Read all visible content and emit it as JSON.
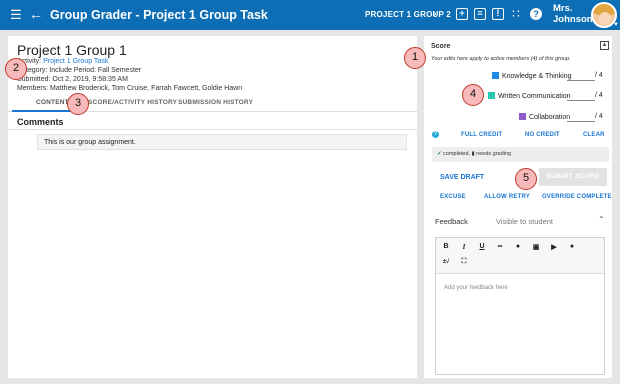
{
  "topbar": {
    "title": "Group Grader - Project 1 Group Task",
    "crumb": "PROJECT 1 GROUP 2",
    "user_first": "Mrs.",
    "user_last": "Johnson",
    "bg_color": "#0d6eb5"
  },
  "left": {
    "project_title": "Project 1 Group 1",
    "activity_label": "Activity:",
    "activity_link": "Project 1 Group Task",
    "category_line": "Category: Include   Period: Fall Semester",
    "submitted_line": "Submitted: Oct 2, 2019, 9:58:35 AM",
    "members_line": "Members:  Matthew Broderick, Tom Cruise, Farrah Fawcett, Goldie Hawn",
    "tabs": [
      {
        "label": "CONTENT"
      },
      {
        "label": "SCORE/ACTIVITY HISTORY"
      },
      {
        "label": "SUBMISSION HISTORY"
      }
    ],
    "comments_heading": "Comments",
    "comment_text": "This is our group assignment."
  },
  "right": {
    "score_heading": "Score",
    "score_note": "Your edits here apply to active members (4) of this group.",
    "criteria": [
      {
        "name": "Knowledge & Thinking",
        "max": "/ 4",
        "color": "#1e88e5"
      },
      {
        "name": "Written Communication",
        "max": "/ 4",
        "color": "#26c6b0"
      },
      {
        "name": "Collaboration",
        "max": "/ 4",
        "color": "#8e5cc9"
      }
    ],
    "full_credit": "FULL CREDIT",
    "no_credit": "NO CREDIT",
    "clear": "CLEAR",
    "status_completed": "completed,",
    "status_needs": "needs grading",
    "save_draft": "SAVE DRAFT",
    "submit_score": "SUBMIT SCORE",
    "excuse": "EXCUSE",
    "allow_retry": "ALLOW RETRY",
    "override_complete": "OVERRIDE COMPLETE",
    "feedback_heading": "Feedback",
    "feedback_visibility": "Visible to student",
    "feedback_placeholder": "Add your feedback here"
  },
  "callouts": [
    "1",
    "2",
    "3",
    "4",
    "5"
  ],
  "icons": [
    "menu-icon",
    "back-arrow-icon",
    "chevron-right-icon",
    "add-icon",
    "clipboard-icon",
    "flag-icon",
    "apps-grid-icon",
    "help-icon",
    "collapse-icon"
  ]
}
